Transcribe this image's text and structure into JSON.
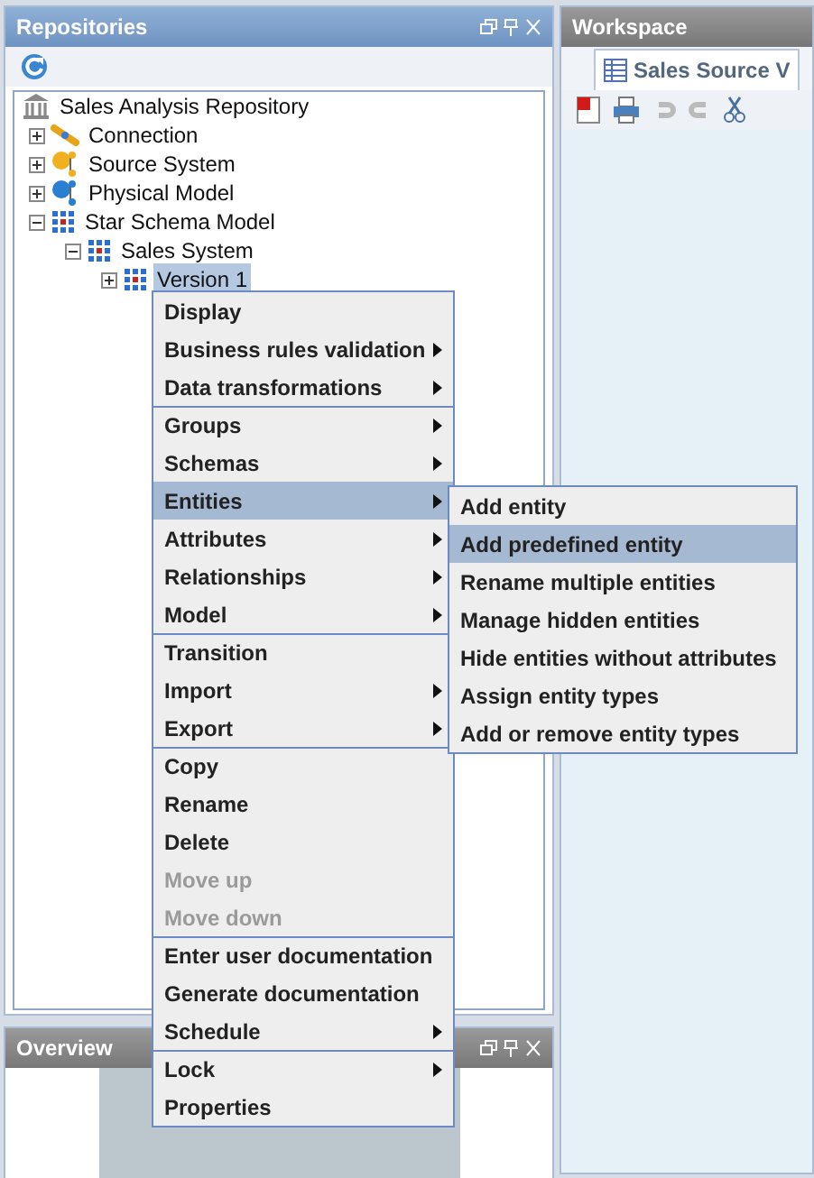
{
  "repositories": {
    "title": "Repositories",
    "tree": [
      {
        "label": "Sales Analysis Repository",
        "kind": "repository",
        "selected": false,
        "children": [
          {
            "label": "Connection",
            "kind": "connection",
            "expanded": false,
            "selected": false
          },
          {
            "label": "Source System",
            "kind": "source",
            "expanded": false,
            "selected": false
          },
          {
            "label": "Physical Model",
            "kind": "physical",
            "expanded": false,
            "selected": false
          },
          {
            "label": "Star Schema Model",
            "kind": "schema",
            "expanded": true,
            "selected": false,
            "children": [
              {
                "label": "Sales System",
                "kind": "schema",
                "expanded": true,
                "selected": false,
                "children": [
                  {
                    "label": "Version 1",
                    "kind": "schema",
                    "expanded": false,
                    "selected": true
                  }
                ]
              }
            ]
          }
        ]
      }
    ]
  },
  "overview": {
    "title": "Overview"
  },
  "workspace": {
    "title": "Workspace",
    "tab": "Sales Source V"
  },
  "context_menu": {
    "groups": [
      [
        {
          "label": "Display",
          "submenu": false,
          "disabled": false,
          "selected": false
        },
        {
          "label": "Business rules validation",
          "submenu": true,
          "disabled": false,
          "selected": false
        },
        {
          "label": "Data transformations",
          "submenu": true,
          "disabled": false,
          "selected": false
        }
      ],
      [
        {
          "label": "Groups",
          "submenu": true,
          "disabled": false,
          "selected": false
        },
        {
          "label": "Schemas",
          "submenu": true,
          "disabled": false,
          "selected": false
        },
        {
          "label": "Entities",
          "submenu": true,
          "disabled": false,
          "selected": true
        },
        {
          "label": "Attributes",
          "submenu": true,
          "disabled": false,
          "selected": false
        },
        {
          "label": "Relationships",
          "submenu": true,
          "disabled": false,
          "selected": false
        },
        {
          "label": "Model",
          "submenu": true,
          "disabled": false,
          "selected": false
        }
      ],
      [
        {
          "label": "Transition",
          "submenu": false,
          "disabled": false,
          "selected": false
        },
        {
          "label": "Import",
          "submenu": true,
          "disabled": false,
          "selected": false
        },
        {
          "label": "Export",
          "submenu": true,
          "disabled": false,
          "selected": false
        }
      ],
      [
        {
          "label": "Copy",
          "submenu": false,
          "disabled": false,
          "selected": false
        },
        {
          "label": "Rename",
          "submenu": false,
          "disabled": false,
          "selected": false
        },
        {
          "label": "Delete",
          "submenu": false,
          "disabled": false,
          "selected": false
        },
        {
          "label": "Move up",
          "submenu": false,
          "disabled": true,
          "selected": false
        },
        {
          "label": "Move down",
          "submenu": false,
          "disabled": true,
          "selected": false
        }
      ],
      [
        {
          "label": "Enter user documentation",
          "submenu": false,
          "disabled": false,
          "selected": false
        },
        {
          "label": "Generate documentation",
          "submenu": false,
          "disabled": false,
          "selected": false
        },
        {
          "label": "Schedule",
          "submenu": true,
          "disabled": false,
          "selected": false
        }
      ],
      [
        {
          "label": "Lock",
          "submenu": true,
          "disabled": false,
          "selected": false
        },
        {
          "label": "Properties",
          "submenu": false,
          "disabled": false,
          "selected": false
        }
      ]
    ]
  },
  "submenu": [
    {
      "label": "Add entity",
      "selected": false
    },
    {
      "label": "Add predefined entity",
      "selected": true
    },
    {
      "label": "Rename multiple entities",
      "selected": false
    },
    {
      "label": "Manage hidden entities",
      "selected": false
    },
    {
      "label": "Hide entities without attributes",
      "selected": false
    },
    {
      "label": "Assign entity types",
      "selected": false
    },
    {
      "label": "Add or remove entity types",
      "selected": false
    }
  ]
}
